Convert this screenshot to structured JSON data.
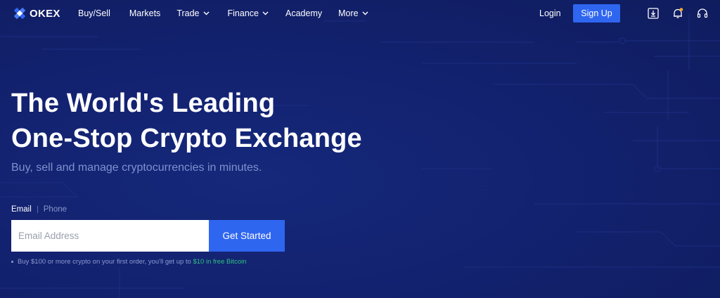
{
  "brand": {
    "name": "OKEX"
  },
  "nav": {
    "items": [
      {
        "label": "Buy/Sell",
        "dropdown": false
      },
      {
        "label": "Markets",
        "dropdown": false
      },
      {
        "label": "Trade",
        "dropdown": true
      },
      {
        "label": "Finance",
        "dropdown": true
      },
      {
        "label": "Academy",
        "dropdown": false
      },
      {
        "label": "More",
        "dropdown": true
      }
    ],
    "login": "Login",
    "signup": "Sign Up",
    "icons": [
      "download-icon",
      "bell-icon",
      "headset-icon"
    ]
  },
  "hero": {
    "title_line1": "The World's Leading",
    "title_line2": "One-Stop Crypto Exchange",
    "subtitle": "Buy, sell and manage cryptocurrencies in minutes."
  },
  "signup_form": {
    "tabs": [
      {
        "label": "Email",
        "active": true
      },
      {
        "label": "Phone",
        "active": false
      }
    ],
    "email_placeholder": "Email Address",
    "submit": "Get Started",
    "promo_text": "Buy $100 or more crypto on your first order, you'll get up to",
    "promo_highlight": "$10 in free Bitcoin"
  },
  "colors": {
    "background": "#122069",
    "accent": "#2f66f0",
    "promo_highlight": "#2fc27f",
    "notification_dot": "#f5a623"
  }
}
